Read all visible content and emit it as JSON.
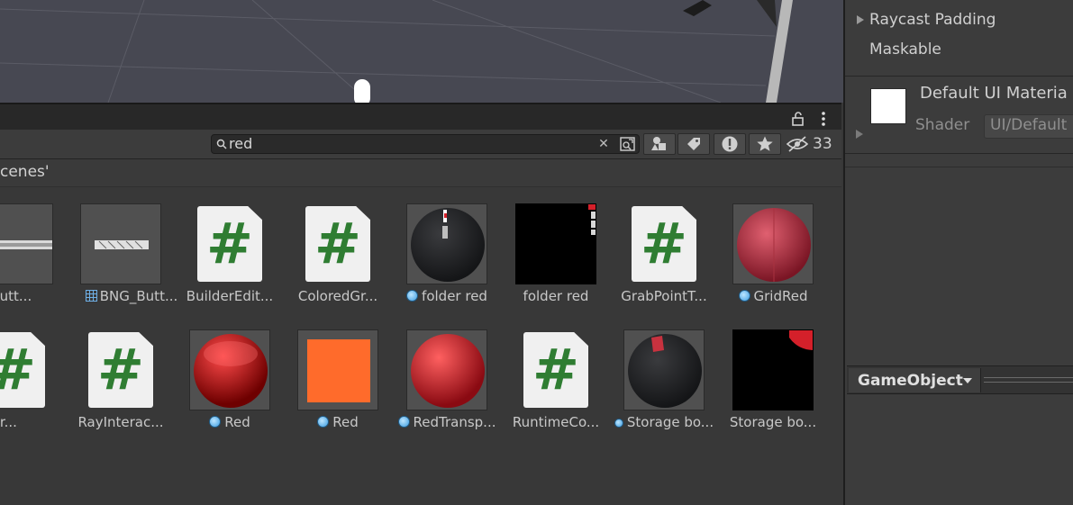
{
  "project_panel": {
    "search": {
      "value": "red",
      "placeholder": ""
    },
    "hidden_count": "33",
    "breadcrumb": "cenes'"
  },
  "assets": [
    {
      "label": "NG_Butt..."
    },
    {
      "label": "BNG_Butt..."
    },
    {
      "label": "BuilderEdit..."
    },
    {
      "label": "ColoredGr..."
    },
    {
      "label": "folder red"
    },
    {
      "label": "folder red"
    },
    {
      "label": "GrabPointT..."
    },
    {
      "label": "GridRed"
    },
    {
      "label": "ticolor..."
    },
    {
      "label": "RayInterac..."
    },
    {
      "label": "Red"
    },
    {
      "label": "Red"
    },
    {
      "label": "RedTransp..."
    },
    {
      "label": "RuntimeCo..."
    },
    {
      "label": "Storage bo..."
    },
    {
      "label": "Storage bo..."
    }
  ],
  "inspector": {
    "raycast_padding": "Raycast Padding",
    "maskable": "Maskable",
    "material_name": "Default UI Materia",
    "shader_label": "Shader",
    "shader_value": "UI/Default",
    "gameobject_menu": "GameObject"
  },
  "colors": {
    "script_hash": "#2f7d32",
    "accent_orange": "#ff6b2b",
    "accent_red": "#d4202a"
  }
}
